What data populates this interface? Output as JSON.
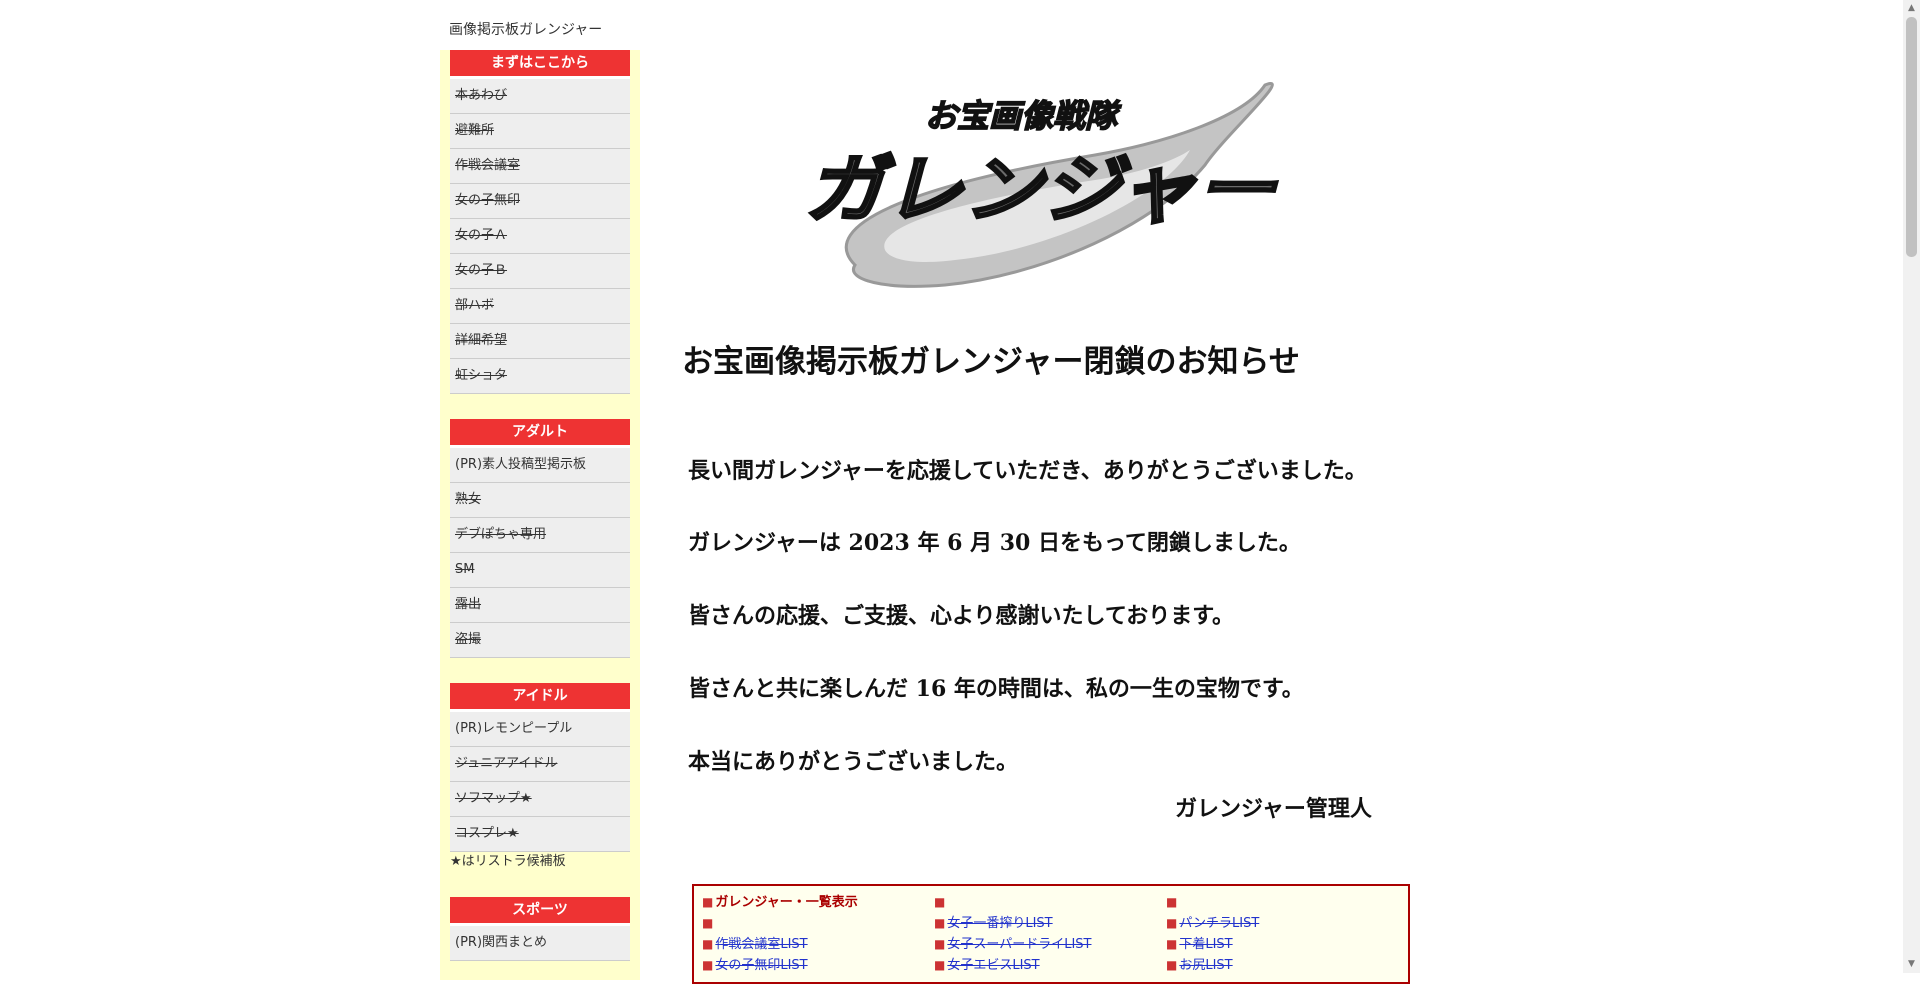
{
  "site_title": "画像掲示板ガレンジャー",
  "sidebar": {
    "sections": [
      {
        "header": "まずはここから",
        "items": [
          {
            "label": "本あわび",
            "live": false
          },
          {
            "label": "避難所",
            "live": false
          },
          {
            "label": "作戦会議室",
            "live": false
          },
          {
            "label": "女の子無印",
            "live": false
          },
          {
            "label": "女の子Ａ",
            "live": false
          },
          {
            "label": "女の子Ｂ",
            "live": false
          },
          {
            "label": "部ハボ",
            "live": false
          },
          {
            "label": "詳細希望",
            "live": false
          },
          {
            "label": "虹ショタ",
            "live": false
          }
        ]
      },
      {
        "header": "アダルト",
        "items": [
          {
            "label": "(PR)素人投稿型掲示板",
            "live": true
          },
          {
            "label": "熟女",
            "live": false
          },
          {
            "label": "デブぽちゃ専用",
            "live": false
          },
          {
            "label": "SM",
            "live": false
          },
          {
            "label": "露出",
            "live": false
          },
          {
            "label": "盗撮",
            "live": false
          }
        ]
      },
      {
        "header": "アイドル",
        "items": [
          {
            "label": "(PR)レモンピープル",
            "live": true
          },
          {
            "label": "ジュニアアイドル",
            "live": false
          },
          {
            "label": "ソフマップ★",
            "live": false
          },
          {
            "label": "コスプレ★",
            "live": false
          }
        ],
        "note": "★はリストラ候補板"
      },
      {
        "header": "スポーツ",
        "items": [
          {
            "label": "(PR)関西まとめ",
            "live": true
          }
        ]
      }
    ]
  },
  "logo": {
    "top_text": "お宝画像戦隊",
    "main_text": "ガレンジャー",
    "colors": {
      "swoosh": "#bbbbbb",
      "text_fill": "#666666",
      "text_stroke": "#111111"
    }
  },
  "notice": {
    "title": "お宝画像掲示板ガレンジャー閉鎖のお知らせ",
    "lines": [
      "長い間ガレンジャーを応援していただき、ありがとうございました。",
      "ガレンジャーは 2023 年 6 月 30 日をもって閉鎖しました。",
      "皆さんの応援、ご支援、心より感謝いたしております。",
      "皆さんと共に楽しんだ 16 年の時間は、私の一生の宝物です。",
      "本当にありがとうございました。"
    ],
    "signature": "ガレンジャー管理人"
  },
  "list_box": {
    "columns": [
      [
        "ガレンジャー・一覧表示",
        "",
        "作戦会議室LIST",
        "女の子無印LIST"
      ],
      [
        "",
        "女子一番搾りLIST",
        "女子スーパードライLIST",
        "女子エビスLIST"
      ],
      [
        "",
        "パンチラLIST",
        "下着LIST",
        "お尻LIST"
      ]
    ]
  },
  "colors": {
    "accent_red": "#ee3333",
    "sidebar_bg": "#ffffcc",
    "link_blue": "#2233cc"
  }
}
